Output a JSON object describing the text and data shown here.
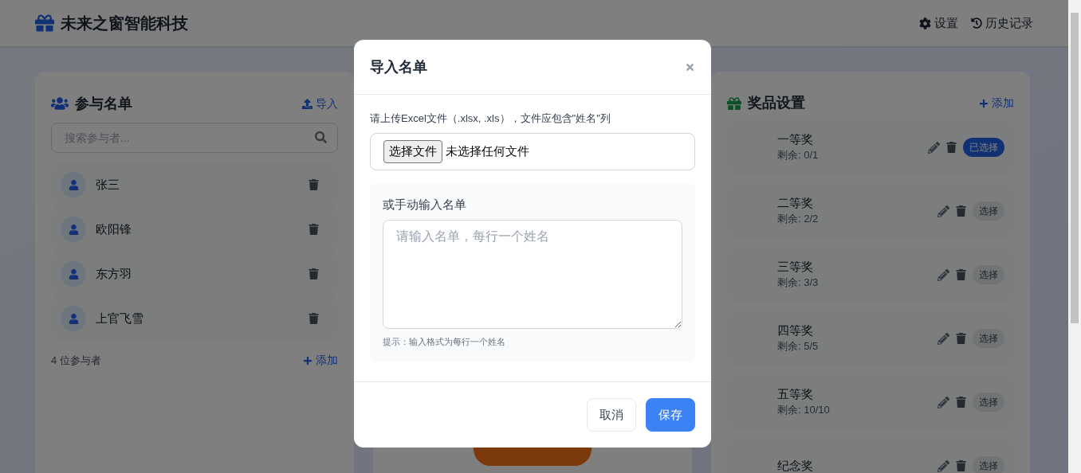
{
  "header": {
    "title": "未来之窗智能科技",
    "links": [
      {
        "label": "设置",
        "kind": "settings"
      },
      {
        "label": "历史记录",
        "kind": "history"
      }
    ]
  },
  "participants": {
    "title": "参与名单",
    "import_label": "导入",
    "search_placeholder": "搜索参与者...",
    "people": [
      {
        "name": "张三"
      },
      {
        "name": "欧阳锋"
      },
      {
        "name": "东方羽"
      },
      {
        "name": "上官飞雪"
      }
    ],
    "count": "4 位参与者",
    "add_label": "添加"
  },
  "prizes": {
    "title": "奖品设置",
    "add_label": "添加",
    "items": [
      {
        "name": "一等奖",
        "remaining": "剩余: 0/1",
        "selected": true,
        "button_label": "已选择"
      },
      {
        "name": "二等奖",
        "remaining": "剩余: 2/2",
        "selected": false,
        "button_label": "选择"
      },
      {
        "name": "三等奖",
        "remaining": "剩余: 3/3",
        "selected": false,
        "button_label": "选择"
      },
      {
        "name": "四等奖",
        "remaining": "剩余: 5/5",
        "selected": false,
        "button_label": "选择"
      },
      {
        "name": "五等奖",
        "remaining": "剩余: 10/10",
        "selected": false,
        "button_label": "选择"
      },
      {
        "name": "纪念奖",
        "selected": false,
        "button_label": "选择"
      }
    ]
  },
  "modal": {
    "title": "导入名单",
    "instruction": "请上传Excel文件（.xlsx, .xls），文件应包含\"姓名\"列",
    "file_button": "选择文件",
    "file_status": "未选择任何文件",
    "manual_label": "或手动输入名单",
    "textarea_placeholder": "请输入名单，每行一个姓名",
    "hint": "提示：输入格式为每行一个姓名",
    "buttons": [
      {
        "label": "取消",
        "kind": "secondary"
      },
      {
        "label": "保存",
        "kind": "primary"
      }
    ]
  }
}
